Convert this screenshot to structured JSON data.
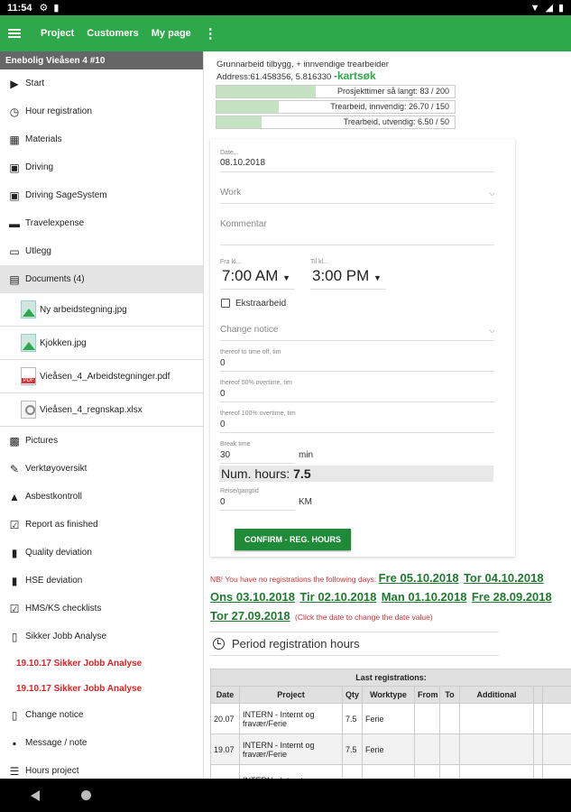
{
  "status": {
    "time": "11:54",
    "left_icons": [
      "gear-icon",
      "card-icon"
    ],
    "right_icons": [
      "wifi-icon",
      "signal-icon",
      "battery-icon"
    ]
  },
  "appbar": {
    "nav": [
      "Project",
      "Customers",
      "My page"
    ],
    "color": "#2ea84a"
  },
  "sidebar": {
    "project_title": "Enebolig Vieåsen 4 #10",
    "items": [
      {
        "label": "Start",
        "icon": "play-icon"
      },
      {
        "label": "Hour registration",
        "icon": "clock-icon"
      },
      {
        "label": "Materials",
        "icon": "materials-icon"
      },
      {
        "label": "Driving",
        "icon": "car-icon"
      },
      {
        "label": "Driving SageSystem",
        "icon": "car-icon"
      },
      {
        "label": "Travelexpense",
        "icon": "bed-icon"
      },
      {
        "label": "Utlegg",
        "icon": "card-icon"
      },
      {
        "label": "Documents (4)",
        "icon": "documents-icon"
      }
    ],
    "documents": [
      {
        "name": "Ny arbeidstegning.jpg",
        "type": "image"
      },
      {
        "name": "Kjokken.jpg",
        "type": "image"
      },
      {
        "name": "Vieåsen_4_Arbeidstegninger.pdf",
        "type": "pdf"
      },
      {
        "name": "Vieåsen_4_regnskap.xlsx",
        "type": "spreadsheet"
      }
    ],
    "items2": [
      {
        "label": "Pictures",
        "icon": "picture-icon"
      },
      {
        "label": "Verktøyoversikt",
        "icon": "wrench-icon"
      },
      {
        "label": "Asbestkontroll",
        "icon": "warning-icon"
      },
      {
        "label": "Report as finished",
        "icon": "checkbox-icon"
      },
      {
        "label": "Quality deviation",
        "icon": "alert-doc-icon"
      },
      {
        "label": "HSE deviation",
        "icon": "alert-doc-icon"
      },
      {
        "label": "HMS/KS checklists",
        "icon": "checkbox-icon"
      },
      {
        "label": "Sikker Jobb Analyse",
        "icon": "clipboard-icon"
      }
    ],
    "sja_links": [
      "19.10.17 Sikker Jobb Analyse",
      "19.10.17 Sikker Jobb Analyse"
    ],
    "items3": [
      {
        "label": "Change notice",
        "icon": "clipboard-icon"
      },
      {
        "label": "Message / note",
        "icon": "message-icon"
      },
      {
        "label": "Hours project",
        "icon": "list-icon"
      }
    ]
  },
  "info": {
    "description": "Grunnarbeid tilbygg, + innvendige trearbeider",
    "address": "Address:61.458356, 5.816330",
    "map_link": "-kartsøk"
  },
  "progress": [
    {
      "label": "Prosjekttimer så langt: 83 / 200",
      "fraction": 0.415
    },
    {
      "label": "Trearbeid, innvendig: 26.70 / 150",
      "fraction": 0.178
    },
    {
      "label": "Trearbeid, utvendig: 6.50 / 50",
      "fraction": 0.13
    }
  ],
  "form": {
    "date_label": "Date...",
    "date_value": "08.10.2018",
    "work_placeholder": "Work",
    "comment_placeholder": "Kommentar",
    "from_label": "Fra kl...",
    "from_value": "7:00 AM",
    "to_label": "Til kl...",
    "to_value": "3:00 PM",
    "extra_label": "Ekstraarbeid",
    "change_notice_placeholder": "Change notice",
    "timeoff_label": "thereof to time off, tim",
    "timeoff_value": "0",
    "ot50_label": "thereof 50% overtime, tim",
    "ot50_value": "0",
    "ot100_label": "thereof 100% overtime, tim",
    "ot100_value": "0",
    "break_label": "Break time",
    "break_value": "30",
    "break_unit": "min",
    "num_hours_label": "Num. hours:",
    "num_hours_value": "7.5",
    "travel_label": "Reise/gangtid",
    "travel_value": "0",
    "travel_unit": "KM",
    "confirm_label": "CONFIRM - REG. HOURS"
  },
  "nb": {
    "text": "NB! You have no registrations the following days:",
    "dates": [
      "Fre 05.10.2018",
      "Tor 04.10.2018",
      "Ons 03.10.2018",
      "Tir 02.10.2018",
      "Man 01.10.2018",
      "Fre 28.09.2018",
      "Tor 27.09.2018"
    ],
    "hint": "(Click the date to change the date value)"
  },
  "period": {
    "title": "Period registration hours"
  },
  "table": {
    "caption": "Last registrations:",
    "headers": [
      "Date",
      "Project",
      "Qty",
      "Worktype",
      "From",
      "To",
      "Additional"
    ],
    "rows": [
      [
        "20.07",
        "INTERN - Internt og fravær/Ferie",
        "7.5",
        "Ferie",
        "",
        "",
        ""
      ],
      [
        "19.07",
        "INTERN - Internt og fravær/Ferie",
        "7.5",
        "Ferie",
        "",
        "",
        ""
      ],
      [
        "",
        "INTERN - Internt og",
        "",
        "",
        "",
        "",
        ""
      ]
    ]
  }
}
